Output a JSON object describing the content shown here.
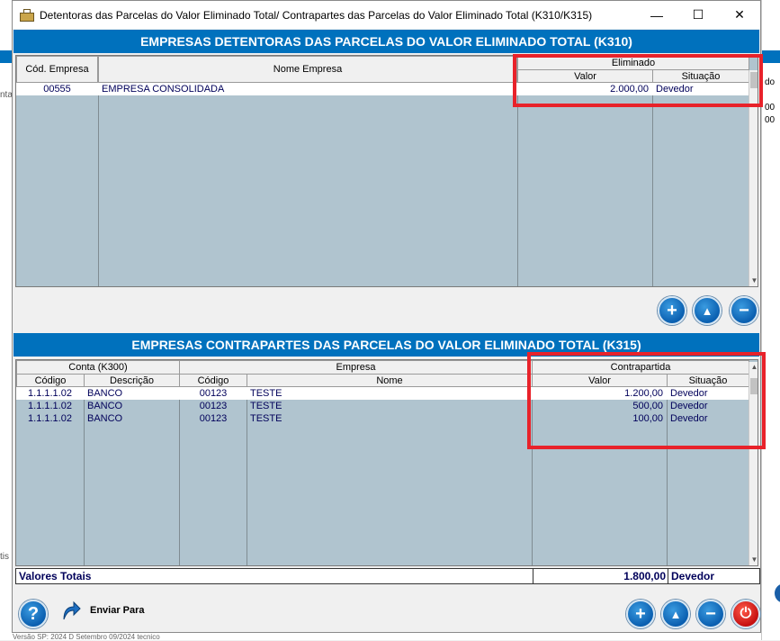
{
  "window": {
    "title": "Detentoras das Parcelas  do Valor Eliminado Total/ Contrapartes das Parcelas do Valor Eliminado Total (K310/K315)",
    "minimize_glyph": "—",
    "maximize_glyph": "☐",
    "close_glyph": "✕"
  },
  "k310": {
    "header": "EMPRESAS DETENTORAS DAS PARCELAS DO VALOR ELIMINADO TOTAL (K310)",
    "columns": {
      "cod_empresa": "Cód. Empresa",
      "nome_empresa": "Nome Empresa",
      "eliminado": "Eliminado",
      "valor": "Valor",
      "situacao": "Situação"
    },
    "rows": [
      {
        "cod": "00555",
        "nome": "EMPRESA CONSOLIDADA",
        "valor": "2.000,00",
        "situacao": "Devedor"
      }
    ]
  },
  "k315": {
    "header": "EMPRESAS CONTRAPARTES DAS PARCELAS DO VALOR ELIMINADO TOTAL (K315)",
    "columns": {
      "conta": "Conta (K300)",
      "empresa": "Empresa",
      "contrapartida": "Contrapartida",
      "codigo": "Código",
      "descricao": "Descrição",
      "emp_codigo": "Código",
      "nome": "Nome",
      "valor": "Valor",
      "situacao": "Situação"
    },
    "rows": [
      {
        "conta": "1.1.1.1.02",
        "descricao": "BANCO",
        "emp_codigo": "00123",
        "nome": "TESTE",
        "valor": "1.200,00",
        "situacao": "Devedor"
      },
      {
        "conta": "1.1.1.1.02",
        "descricao": "BANCO",
        "emp_codigo": "00123",
        "nome": "TESTE",
        "valor": "500,00",
        "situacao": "Devedor"
      },
      {
        "conta": "1.1.1.1.02",
        "descricao": "BANCO",
        "emp_codigo": "00123",
        "nome": "TESTE",
        "valor": "100,00",
        "situacao": "Devedor"
      }
    ],
    "totals": {
      "label": "Valores Totais",
      "valor": "1.800,00",
      "situacao": "Devedor"
    }
  },
  "buttons": {
    "add": "+",
    "up": "▲",
    "remove": "−",
    "help": "?",
    "send_label": "Enviar Para",
    "power": "⏻"
  },
  "background": {
    "bottom_text": "Versão   SP: 2024 D                                                     Setembro   09/2024                          tecnico",
    "right_texts": [
      "do",
      "00",
      "00"
    ],
    "left_texts": [
      "nta",
      "tis"
    ]
  },
  "colors": {
    "header_blue": "#0071bd",
    "grid_bg": "#b0c4cf",
    "highlight_red": "#e8222a",
    "text_navy": "#00005a"
  }
}
